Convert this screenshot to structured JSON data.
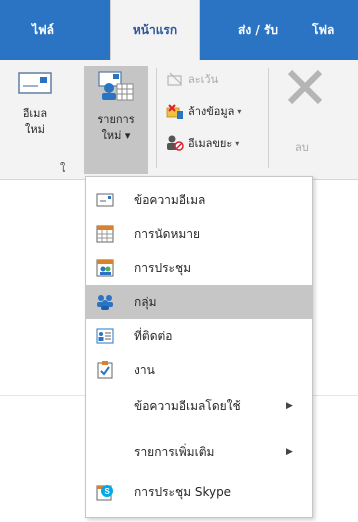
{
  "tabs": [
    {
      "label": "ไฟล์",
      "active": false
    },
    {
      "label": "หน้าแรก",
      "active": true
    },
    {
      "label": "ส่ง / รับ",
      "active": false
    },
    {
      "label": "โฟล",
      "active": false
    }
  ],
  "ribbon": {
    "new_email": {
      "label": "อีเมล\nใหม่"
    },
    "new_items": {
      "label": "รายการ\nใหม่ ▾"
    },
    "group_label": "ใ",
    "ignore": {
      "label": "ละเว้น"
    },
    "clean_up": {
      "label": "ล้างข้อมูล"
    },
    "junk": {
      "label": "อีเมลขยะ"
    },
    "delete": {
      "label": "ลบ"
    }
  },
  "menu": {
    "items": [
      {
        "label": "ข้อความอีเมล",
        "icon": "email-message-icon"
      },
      {
        "label": "การนัดหมาย",
        "icon": "calendar-icon"
      },
      {
        "label": "การประชุม",
        "icon": "meeting-icon"
      },
      {
        "label": "กลุ่ม",
        "icon": "group-icon",
        "highlighted": true
      },
      {
        "label": "ที่ติดต่อ",
        "icon": "contact-card-icon"
      },
      {
        "label": "งาน",
        "icon": "task-icon"
      },
      {
        "label": "ข้อความอีเมลโดยใช้",
        "has_submenu": true
      },
      {
        "label": "รายการเพิ่มเติม",
        "has_submenu": true
      },
      {
        "label": "การประชุม Skype",
        "icon": "skype-meeting-icon"
      }
    ]
  },
  "colors": {
    "accent": "#2b74c4",
    "ribbon_bg": "#f3f3f3",
    "hover": "#c6c6c6"
  }
}
